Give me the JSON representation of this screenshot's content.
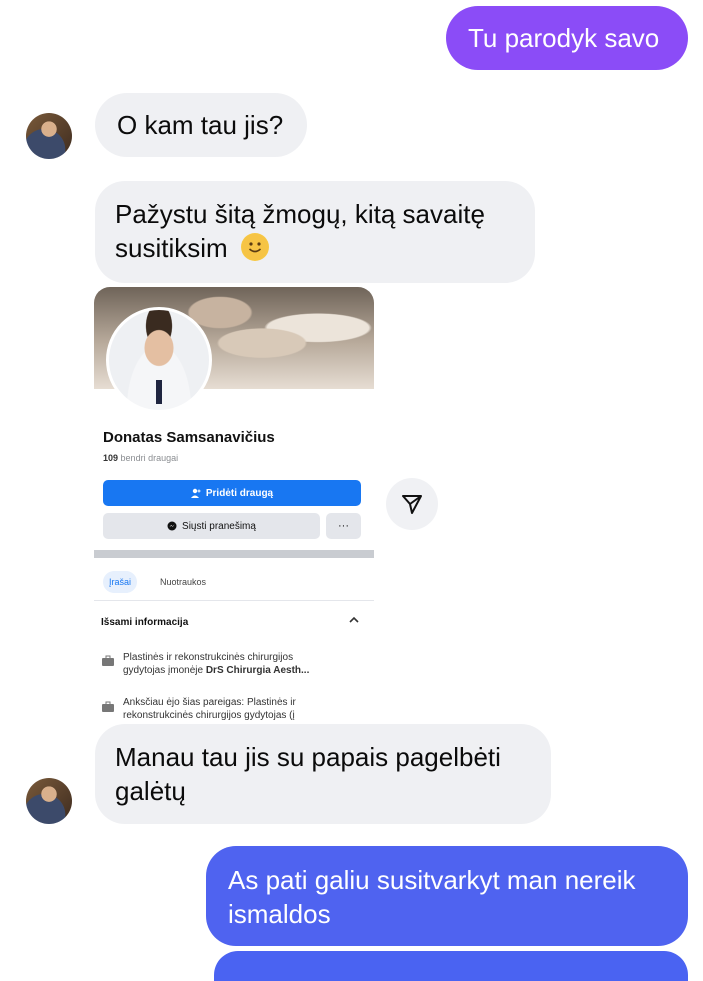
{
  "messages": {
    "out1": "Tu parodyk savo",
    "in1": "O kam tau jis?",
    "in2_line1": "Pažystu šitą žmogų, kitą savaitę",
    "in2_line2": "susitiksim",
    "in2_emoji": "🙂",
    "in3_line1": "Manau tau jis su papais pagelbėti",
    "in3_line2": "galėtų",
    "out2_line1": "As pati galiu susitvarkyt man nereik",
    "out2_line2": "ismaldos"
  },
  "card": {
    "name": "Donatas Samsanavičius",
    "mutual_count": "109",
    "mutual_label": "bendri draugai",
    "add_friend": "Pridėti draugą",
    "send_message": "Siųsti pranešimą",
    "more": "···",
    "tab_posts": "Įrašai",
    "tab_photos": "Nuotraukos",
    "details_title": "Išsami informacija",
    "info1_line1": "Plastinės ir rekonstrukcinės chirurgijos",
    "info1_line2_prefix": "gydytojas įmonėje ",
    "info1_line2_company": "DrS Chirurgia Aesth...",
    "info2_line1": "Anksčiau ėjo šias pareigas: Plastinės ir",
    "info2_line2": "rekonstrukcinės chirurgijos gydytojas (į"
  },
  "colors": {
    "outgoing_purple": "#8b4cf7",
    "outgoing_blue": "#4f63f0",
    "incoming_bg": "#eff0f3",
    "fb_blue": "#1877f2"
  },
  "icons": [
    "send-paper-plane-icon",
    "person-add-icon",
    "messenger-icon",
    "chevron-up-icon",
    "briefcase-icon"
  ]
}
